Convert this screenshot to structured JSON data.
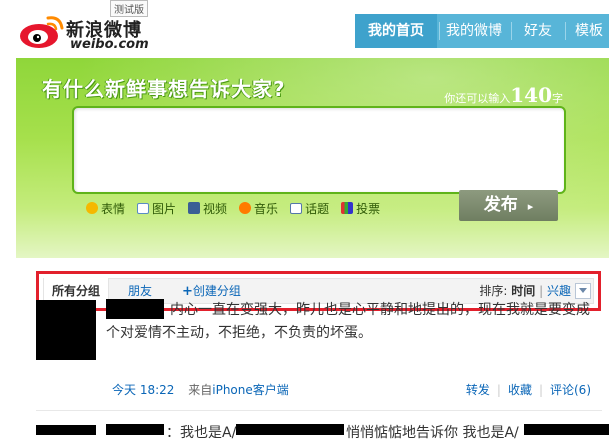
{
  "header": {
    "logo_cn": "新浪微博",
    "logo_en": "weibo.com",
    "beta": "测试版",
    "nav": [
      {
        "label": "我的首页",
        "active": true
      },
      {
        "label": "我的微博",
        "active": false
      },
      {
        "label": "好友",
        "active": false
      },
      {
        "label": "模板",
        "active": false
      }
    ]
  },
  "publish": {
    "headline": "有什么新鲜事想告诉大家?",
    "counter_prefix": "你还可以输入",
    "counter_num": "140",
    "counter_unit": "字",
    "tools": [
      {
        "label": "表情",
        "icon": "smiley-icon"
      },
      {
        "label": "图片",
        "icon": "image-icon"
      },
      {
        "label": "视频",
        "icon": "video-icon"
      },
      {
        "label": "音乐",
        "icon": "music-icon"
      },
      {
        "label": "话题",
        "icon": "topic-icon"
      },
      {
        "label": "投票",
        "icon": "vote-icon"
      }
    ],
    "submit": "发布"
  },
  "filter": {
    "all": "所有分组",
    "friends": "朋友",
    "create_plus": "+",
    "create": "创建分组",
    "sort_label": "排序:",
    "sort_time": "时间",
    "sort_sep": "|",
    "sort_hot": "兴趣"
  },
  "feed": {
    "post1": {
      "text": "内心一直在变强大，昨儿也是心平静和地提出的，现在我就是要变成个对爱情不主动，不拒绝，不负责的坏蛋。",
      "time": "今天 18:22",
      "from_label": "来自",
      "from": "iPhone客户端",
      "repost": "转发",
      "favorite": "收藏",
      "comment": "评论(6)"
    },
    "post2": {
      "text_a": "：我也是A/",
      "text_b": "悄悄惦惦地告诉你 我也是A/"
    }
  },
  "colors": {
    "accent_red": "#e2202c",
    "link_blue": "#0a66b7",
    "nav_blue": "#58b5d8",
    "publish_green": "#8fd63a"
  }
}
